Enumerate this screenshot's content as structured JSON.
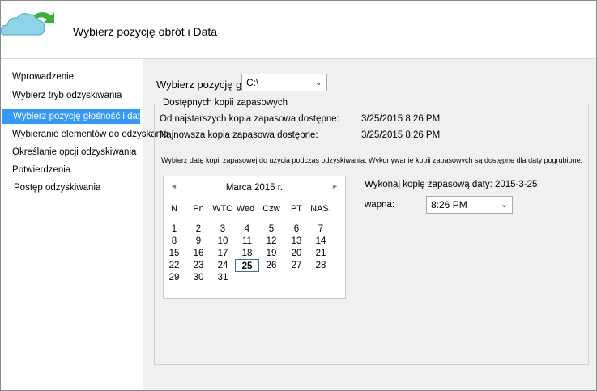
{
  "header": {
    "title": "Wybierz pozycję obrót i  Data"
  },
  "sidebar": {
    "items": [
      {
        "label": "Wprowadzenie"
      },
      {
        "label": "Wybierz tryb odzyskiwania"
      },
      {
        "label": "Wybierz pozycję głośność i daty"
      },
      {
        "label": "Wybieranie elementów do odzyskania"
      },
      {
        "label": "Określanie opcji odzyskiwania"
      },
      {
        "label": "Potwierdzenia"
      },
      {
        "label": "Postęp odzyskiwania"
      }
    ],
    "selected_index": 2
  },
  "main": {
    "volume_label": "Wybierz pozycję głośności",
    "volume_value": "C:\\",
    "group_title": "Dostępnych kopii zapasowych",
    "oldest_label": "Od najstarszych kopia zapasowa dostępne:",
    "oldest_value": "3/25/2015 8:26 PM",
    "newest_label": "Najnowsza kopia zapasowa dostępne:",
    "newest_value": "3/25/2015 8:26 PM",
    "description": "Wybierz datę kopii zapasowej do użycia podczas odzyskiwania. Wykonywanie kopii zapasowych są dostępne dla daty pogrubione.",
    "backup_date_label": "Wykonaj kopię zapasową daty: 2015-3-25",
    "time_label": "wapna:",
    "time_value": "8:26 PM"
  },
  "calendar": {
    "month_title": "Marca 2015 r.",
    "prev_icon": "◄",
    "next_icon": "►",
    "weekdays": [
      "N",
      "Pn",
      "WTO",
      "Wed",
      "Czw",
      "PT",
      "NAS."
    ],
    "weeks": [
      [
        "1",
        "2",
        "3",
        "4",
        "5",
        "6",
        "7"
      ],
      [
        "8",
        "9",
        "10",
        "11",
        "12",
        "13",
        "14"
      ],
      [
        "15",
        "16",
        "17",
        "18",
        "19",
        "20",
        "21"
      ],
      [
        "22",
        "23",
        "24",
        "25",
        "26",
        "27",
        "28"
      ],
      [
        "29",
        "30",
        "31",
        "",
        "",
        "",
        ""
      ]
    ],
    "selected_day": "25"
  },
  "icons": {
    "logo": "cloud-backup-logo",
    "dropdown": "chevron-down-icon",
    "dropdown_glyph": "⌄"
  },
  "colors": {
    "selection": "#3399ff",
    "panel": "#f0f0f0"
  }
}
